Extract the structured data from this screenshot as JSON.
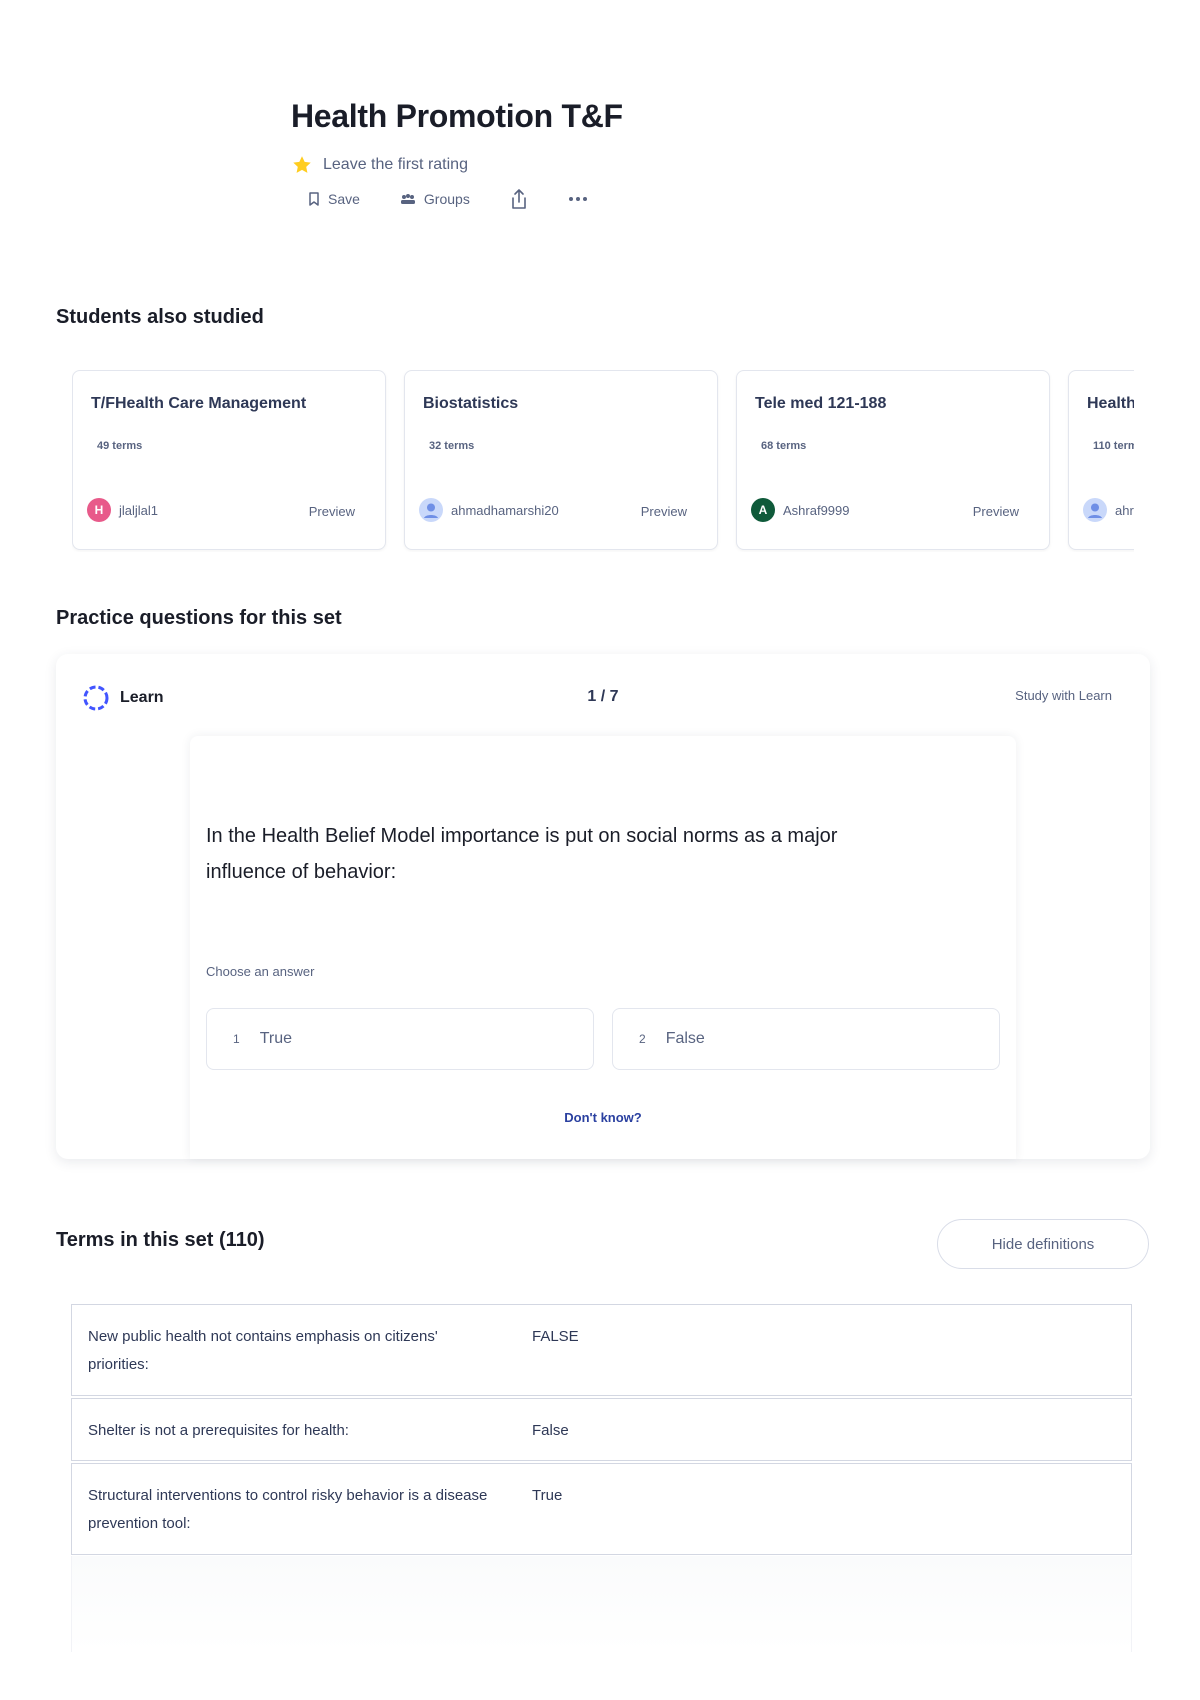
{
  "header": {
    "title": "Health Promotion T&F",
    "rating_text": "Leave the first rating",
    "save_label": "Save",
    "groups_label": "Groups"
  },
  "students_also_studied": {
    "heading": "Students also studied",
    "cards": [
      {
        "title": "T/FHealth Care Management",
        "terms": "49 terms",
        "user": "jlaljlal1",
        "avatar_letter": "H",
        "avatar_color": "#e85a8a",
        "preview": "Preview"
      },
      {
        "title": "Biostatistics",
        "terms": "32 terms",
        "user": "ahmadhamarshi20",
        "avatar_letter": "",
        "avatar_color": "#a9c2f5",
        "preview": "Preview"
      },
      {
        "title": "Tele med 121-188",
        "terms": "68 terms",
        "user": "Ashraf9999",
        "avatar_letter": "A",
        "avatar_color": "#0f5a3a",
        "preview": "Preview"
      },
      {
        "title": "Health",
        "terms": "110 term",
        "user": "ahr",
        "avatar_letter": "",
        "avatar_color": "#a9c2f5",
        "preview": ""
      }
    ]
  },
  "practice": {
    "heading": "Practice questions for this set",
    "mode_label": "Learn",
    "progress": "1 / 7",
    "study_link": "Study with Learn",
    "question": "In the Health Belief Model importance is put on social norms as a major influence of behavior:",
    "choose_label": "Choose an answer",
    "answers": [
      {
        "num": "1",
        "label": "True"
      },
      {
        "num": "2",
        "label": "False"
      }
    ],
    "dont_know": "Don't know?"
  },
  "terms_section": {
    "heading": "Terms in this set (110)",
    "hide_button": "Hide definitions",
    "rows": [
      {
        "term": "New public health not contains emphasis on citizens' priorities:",
        "definition": "FALSE"
      },
      {
        "term": "Shelter is not a prerequisites for health:",
        "definition": "False"
      },
      {
        "term": "Structural interventions to control risky behavior is a disease prevention tool:",
        "definition": "True"
      }
    ]
  },
  "colors": {
    "star": "#ffcd1f",
    "learn_accent": "#4255ff",
    "link": "#2a40a0"
  }
}
